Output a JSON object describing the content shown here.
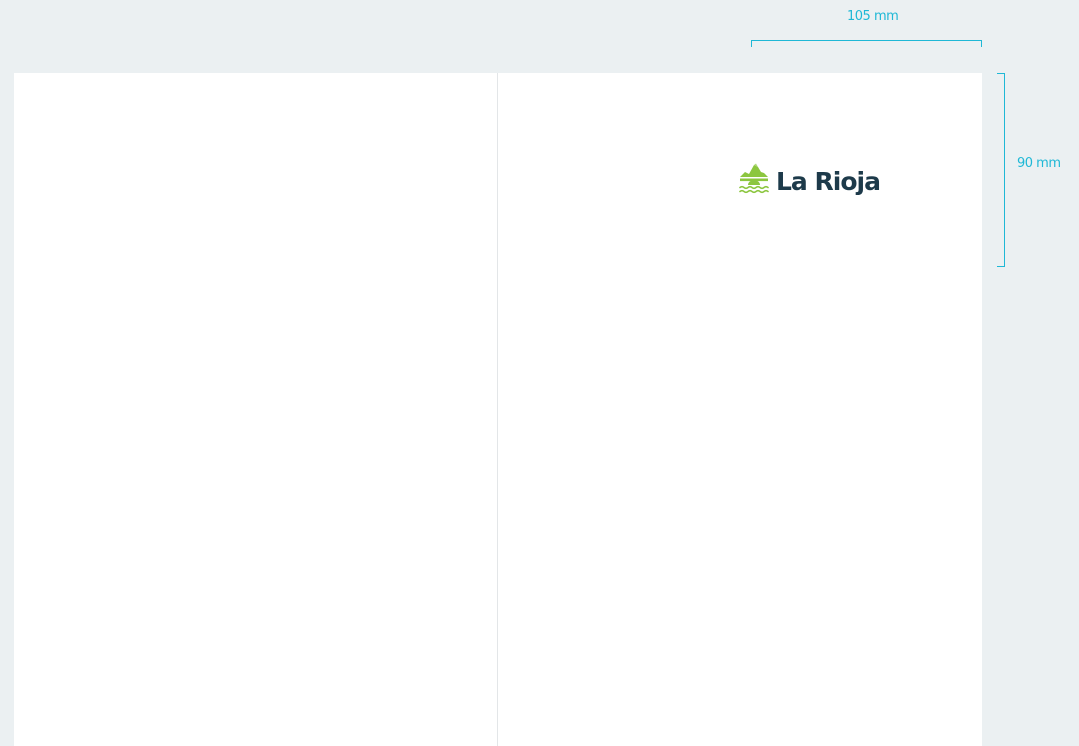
{
  "colors": {
    "background": "#ebf0f2",
    "sheet": "#ffffff",
    "fold_line": "#e3e6e8",
    "dimension": "#1fb8d6",
    "logo_green": "#8cc63f",
    "logo_text": "#1d3a4a"
  },
  "logo": {
    "text": "La Rioja",
    "icon": "la-rioja-emblem-icon"
  },
  "dimensions": {
    "width_label": "105 mm",
    "height_label": "90 mm"
  }
}
